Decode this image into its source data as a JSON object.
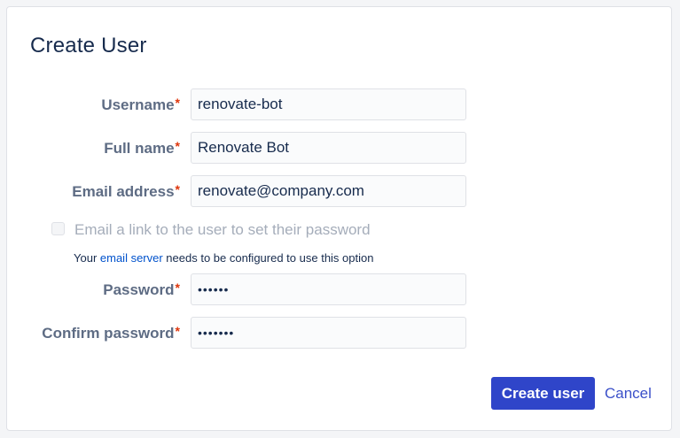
{
  "dialog": {
    "title": "Create User",
    "fields": [
      {
        "label": "Username",
        "value": "renovate-bot",
        "type": "text"
      },
      {
        "label": "Full name",
        "value": "Renovate Bot",
        "type": "text"
      },
      {
        "label": "Email address",
        "value": "renovate@company.com",
        "type": "text"
      },
      {
        "label": "Password",
        "value": "••••••",
        "type": "password"
      },
      {
        "label": "Confirm password",
        "value": "•••••••",
        "type": "password"
      }
    ],
    "required_marker": "*",
    "email_link_checkbox": {
      "label": "Email a link to the user to set their password",
      "checked": false,
      "disabled": true
    },
    "hint": {
      "prefix": "Your ",
      "link": "email server",
      "suffix": " needs to be configured to use this option"
    },
    "buttons": {
      "create": "Create user",
      "cancel": "Cancel"
    }
  },
  "colors": {
    "primary": "#2f45c9",
    "link": "#0052cc",
    "required": "#de350b",
    "label": "#5e6c84"
  }
}
